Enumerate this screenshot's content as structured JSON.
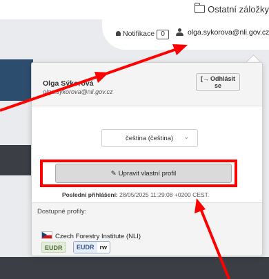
{
  "bookmarks": {
    "folder_label": "Ostatní záložky"
  },
  "header": {
    "notifications_label": "Notifikace",
    "notifications_count": "0",
    "user_email": "olga.sykorova@nli.gov.cz"
  },
  "dropdown": {
    "user_name": "Olga Sýkorová",
    "user_email": "olga.sykorova@nli.gov.cz",
    "logout_label": "Odhlásit se",
    "language_value": "čeština (čeština)",
    "edit_profile_label": "Upravit vlastní profil",
    "last_login_label": "Poslední přihlášení:",
    "last_login_value": "28/05/2025 11:29:08 +0200 CEST.",
    "profiles_label": "Dostupné profily:",
    "organization": "Czech Forestry Institute (NLI)",
    "tag_eudr": "EUDR",
    "tag_eudr_rw_name": "EUDR",
    "tag_eudr_rw_perm": "rw"
  },
  "colors": {
    "annotation": "#ff0000",
    "panel_bg": "#ffffff",
    "section_bg": "#f4f4f4"
  }
}
